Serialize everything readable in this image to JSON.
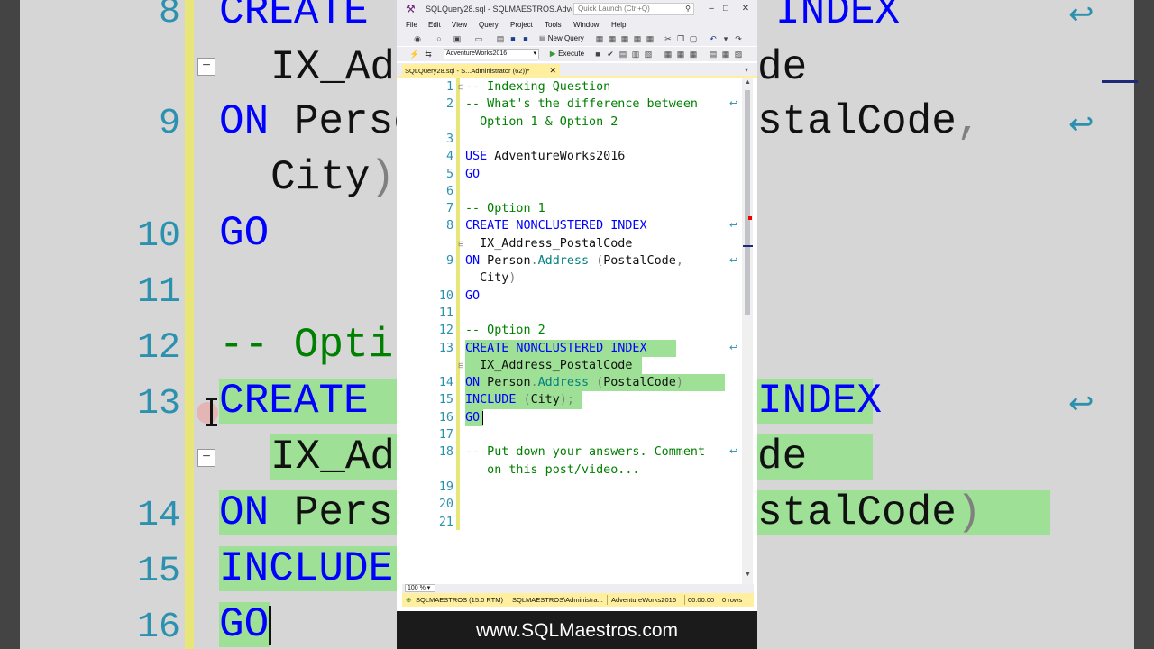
{
  "window": {
    "title": "SQLQuery28.sql - SQLMAESTROS.Adventure...",
    "search_placeholder": "Quick Launch (Ctrl+Q)",
    "search_icon": "search-icon",
    "min": "–",
    "max": "□",
    "close": "✕"
  },
  "menu": [
    "File",
    "Edit",
    "View",
    "Query",
    "Project",
    "Tools",
    "Window",
    "Help"
  ],
  "toolbar": {
    "new_query": "New Query",
    "database": "AdventureWorks2016",
    "execute": "Execute"
  },
  "tab": {
    "label": "SQLQuery28.sql - S...Administrator (62))*",
    "close": "✕"
  },
  "editor": {
    "line_numbers": [
      "1",
      "2",
      "",
      "3",
      "4",
      "5",
      "6",
      "7",
      "8",
      "",
      "9",
      "",
      "10",
      "11",
      "12",
      "13",
      "",
      "14",
      "15",
      "16",
      "17",
      "18",
      "",
      "19",
      "20",
      "21"
    ],
    "lines": [
      {
        "text": "-- Indexing Question",
        "cls": "c"
      },
      {
        "text": "-- What's the difference between",
        "cls": "c"
      },
      {
        "text": "  Option 1 & Option 2",
        "cls": "c"
      },
      {
        "text": "",
        "cls": ""
      },
      {
        "text": "USE AdventureWorks2016",
        "cls": "mix_use"
      },
      {
        "text": "GO",
        "cls": "k"
      },
      {
        "text": "",
        "cls": ""
      },
      {
        "text": "-- Option 1",
        "cls": "c"
      },
      {
        "text": "CREATE NONCLUSTERED INDEX",
        "cls": "k"
      },
      {
        "text": "  IX_Address_PostalCode",
        "cls": ""
      },
      {
        "text": "ON Person.Address (PostalCode,",
        "cls": "mix_on1"
      },
      {
        "text": "  City)",
        "cls": "mix_city"
      },
      {
        "text": "GO",
        "cls": "k"
      },
      {
        "text": "",
        "cls": ""
      },
      {
        "text": "-- Option 2",
        "cls": "c"
      },
      {
        "text": "CREATE NONCLUSTERED INDEX",
        "cls": "k"
      },
      {
        "text": "  IX_Address_PostalCode",
        "cls": ""
      },
      {
        "text": "ON Person.Address (PostalCode)",
        "cls": "mix_on2"
      },
      {
        "text": "INCLUDE (City);",
        "cls": "mix_inc"
      },
      {
        "text": "GO",
        "cls": "k"
      },
      {
        "text": "",
        "cls": ""
      },
      {
        "text": "-- Put down your answers. Comment",
        "cls": "c"
      },
      {
        "text": "   on this post/video...",
        "cls": "c"
      },
      {
        "text": "",
        "cls": ""
      },
      {
        "text": "",
        "cls": ""
      },
      {
        "text": "",
        "cls": ""
      }
    ]
  },
  "zoom": "100 %",
  "status": {
    "server": "SQLMAESTROS (15.0 RTM)",
    "user": "SQLMAESTROS\\Administra...",
    "database": "AdventureWorks2016",
    "time": "00:00:00",
    "rows": "0 rows"
  },
  "footer": "www.SQLMaestros.com",
  "background_zoom": {
    "line_numbers": [
      "8",
      "9",
      "10",
      "11",
      "12",
      "13",
      "14",
      "15",
      "16"
    ]
  },
  "colors": {
    "keyword": "#0000ff",
    "comment": "#008000",
    "line_number": "#2b91af",
    "highlight": "#9fe097",
    "tab_active": "#ffef9e"
  }
}
